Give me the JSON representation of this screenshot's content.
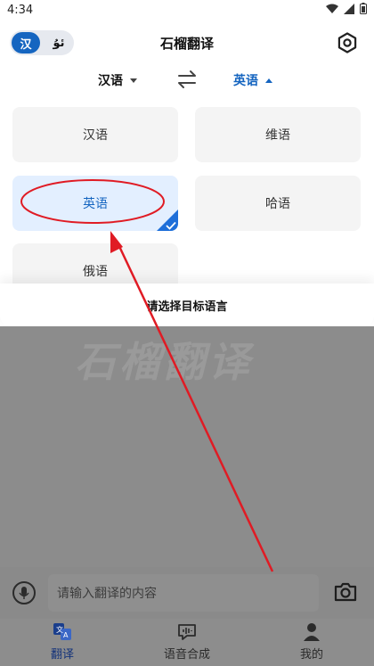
{
  "status_bar": {
    "time": "4:34"
  },
  "header": {
    "lang_switch": {
      "option_a": "汉",
      "option_b": "ئۇ"
    },
    "title": "石榴翻译"
  },
  "language_bar": {
    "source": "汉语",
    "target": "英语"
  },
  "languages": [
    {
      "label": "汉语",
      "selected": false
    },
    {
      "label": "维语",
      "selected": false
    },
    {
      "label": "英语",
      "selected": true
    },
    {
      "label": "哈语",
      "selected": false
    },
    {
      "label": "俄语",
      "selected": false
    }
  ],
  "sheet": {
    "prompt": "请选择目标语言"
  },
  "background": {
    "watermark": "石榴翻译"
  },
  "input": {
    "placeholder": "请输入翻译的内容"
  },
  "tabs": [
    {
      "label": "翻译",
      "icon": "translate-icon",
      "active": true
    },
    {
      "label": "语音合成",
      "icon": "voice-synthesis-icon",
      "active": false
    },
    {
      "label": "我的",
      "icon": "profile-icon",
      "active": false
    }
  ],
  "colors": {
    "accent": "#1565c0",
    "selected_card_bg": "#e3efff",
    "annotation": "#e01b24"
  }
}
